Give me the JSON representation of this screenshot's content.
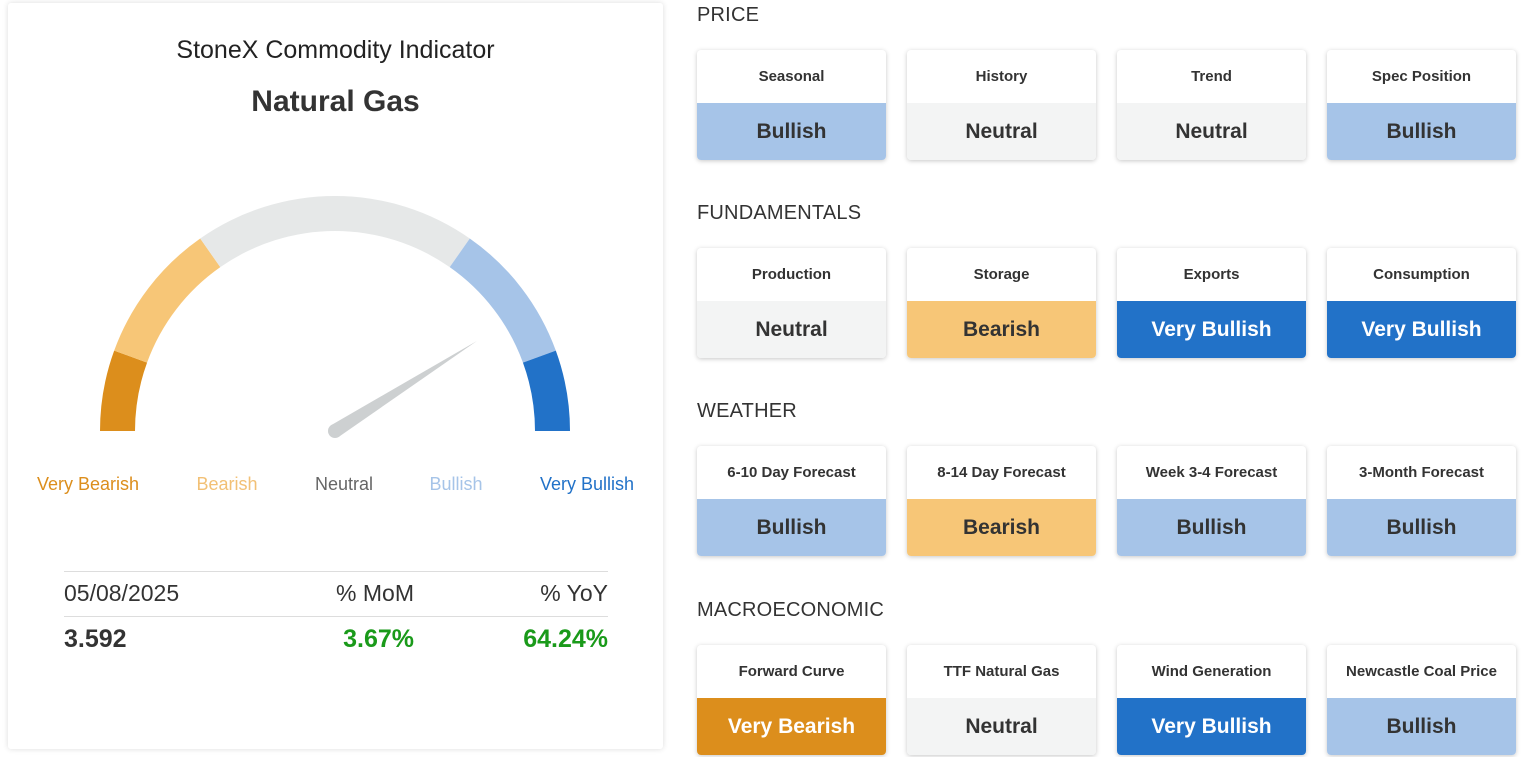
{
  "header": {
    "subtitle": "StoneX Commodity Indicator",
    "title": "Natural Gas"
  },
  "colors": {
    "very_bearish": "#dc8e1c",
    "bearish": "#f7c677",
    "neutral": "#e6e8e8",
    "bullish": "#a6c4e8",
    "very_bullish": "#2272c8",
    "needle": "#cdd0d1",
    "tile_neutral_bg": "#f3f4f4",
    "positive_text": "#1a9a1a"
  },
  "gauge": {
    "value_fraction": 0.82,
    "scale": [
      {
        "key": "very_bearish",
        "label": "Very Bearish"
      },
      {
        "key": "bearish",
        "label": "Bearish"
      },
      {
        "key": "neutral",
        "label": "Neutral"
      },
      {
        "key": "bullish",
        "label": "Bullish"
      },
      {
        "key": "very_bullish",
        "label": "Very Bullish"
      }
    ]
  },
  "stats": {
    "headers": [
      "05/08/2025",
      "% MoM",
      "% YoY"
    ],
    "values": [
      "3.592",
      "3.67%",
      "64.24%"
    ]
  },
  "sections": [
    {
      "title": "PRICE",
      "tiles": [
        {
          "label": "Seasonal",
          "value": "Bullish",
          "level": "bullish"
        },
        {
          "label": "History",
          "value": "Neutral",
          "level": "neutral"
        },
        {
          "label": "Trend",
          "value": "Neutral",
          "level": "neutral"
        },
        {
          "label": "Spec Position",
          "value": "Bullish",
          "level": "bullish"
        }
      ]
    },
    {
      "title": "FUNDAMENTALS",
      "tiles": [
        {
          "label": "Production",
          "value": "Neutral",
          "level": "neutral"
        },
        {
          "label": "Storage",
          "value": "Bearish",
          "level": "bearish"
        },
        {
          "label": "Exports",
          "value": "Very Bullish",
          "level": "very_bullish"
        },
        {
          "label": "Consumption",
          "value": "Very Bullish",
          "level": "very_bullish"
        }
      ]
    },
    {
      "title": "WEATHER",
      "tiles": [
        {
          "label": "6-10 Day Forecast",
          "value": "Bullish",
          "level": "bullish"
        },
        {
          "label": "8-14 Day Forecast",
          "value": "Bearish",
          "level": "bearish"
        },
        {
          "label": "Week 3-4 Forecast",
          "value": "Bullish",
          "level": "bullish"
        },
        {
          "label": "3-Month Forecast",
          "value": "Bullish",
          "level": "bullish"
        }
      ]
    },
    {
      "title": "MACROECONOMIC",
      "tiles": [
        {
          "label": "Forward Curve",
          "value": "Very Bearish",
          "level": "very_bearish"
        },
        {
          "label": "TTF Natural Gas",
          "value": "Neutral",
          "level": "neutral"
        },
        {
          "label": "Wind Generation",
          "value": "Very Bullish",
          "level": "very_bullish"
        },
        {
          "label": "Newcastle Coal Price",
          "value": "Bullish",
          "level": "bullish"
        }
      ]
    }
  ]
}
